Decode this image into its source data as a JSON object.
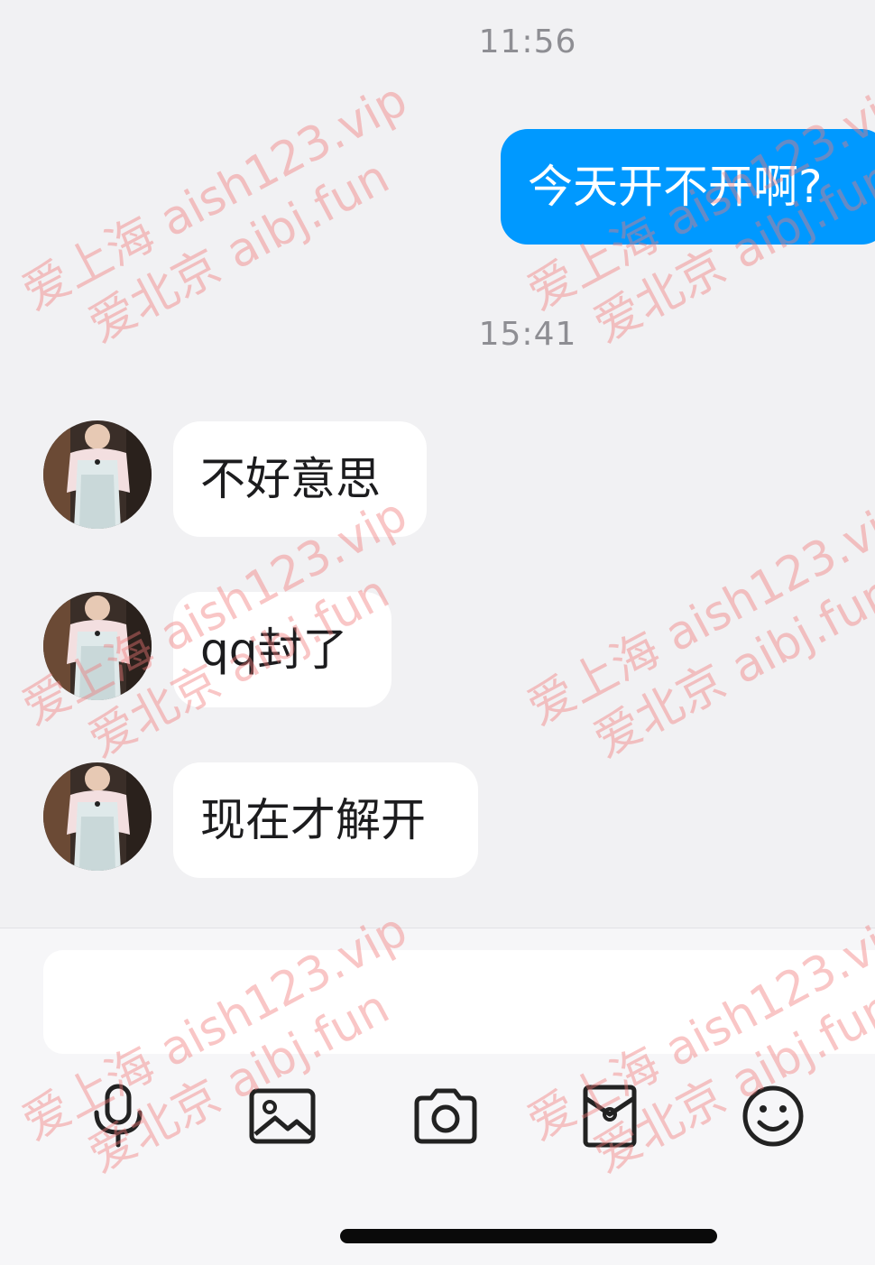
{
  "chat": {
    "time_1": "11:56",
    "time_2": "15:41",
    "messages": [
      {
        "side": "out",
        "text": "今天开不开啊?"
      },
      {
        "side": "in",
        "text": "不好意思"
      },
      {
        "side": "in",
        "text": "qq封了"
      },
      {
        "side": "in",
        "text": "现在才解开"
      }
    ]
  },
  "input": {
    "value": "",
    "placeholder": ""
  },
  "toolbar": {
    "icons": [
      "microphone-icon",
      "image-icon",
      "camera-icon",
      "red-packet-icon",
      "emoji-icon"
    ]
  },
  "watermark": {
    "line1": "爱上海 aish123.vip",
    "line2": "爱北京 aibj.fun"
  },
  "colors": {
    "accent": "#0099ff",
    "background": "#f1f1f3",
    "incoming_bubble": "#ffffff",
    "watermark": "#f07878"
  }
}
